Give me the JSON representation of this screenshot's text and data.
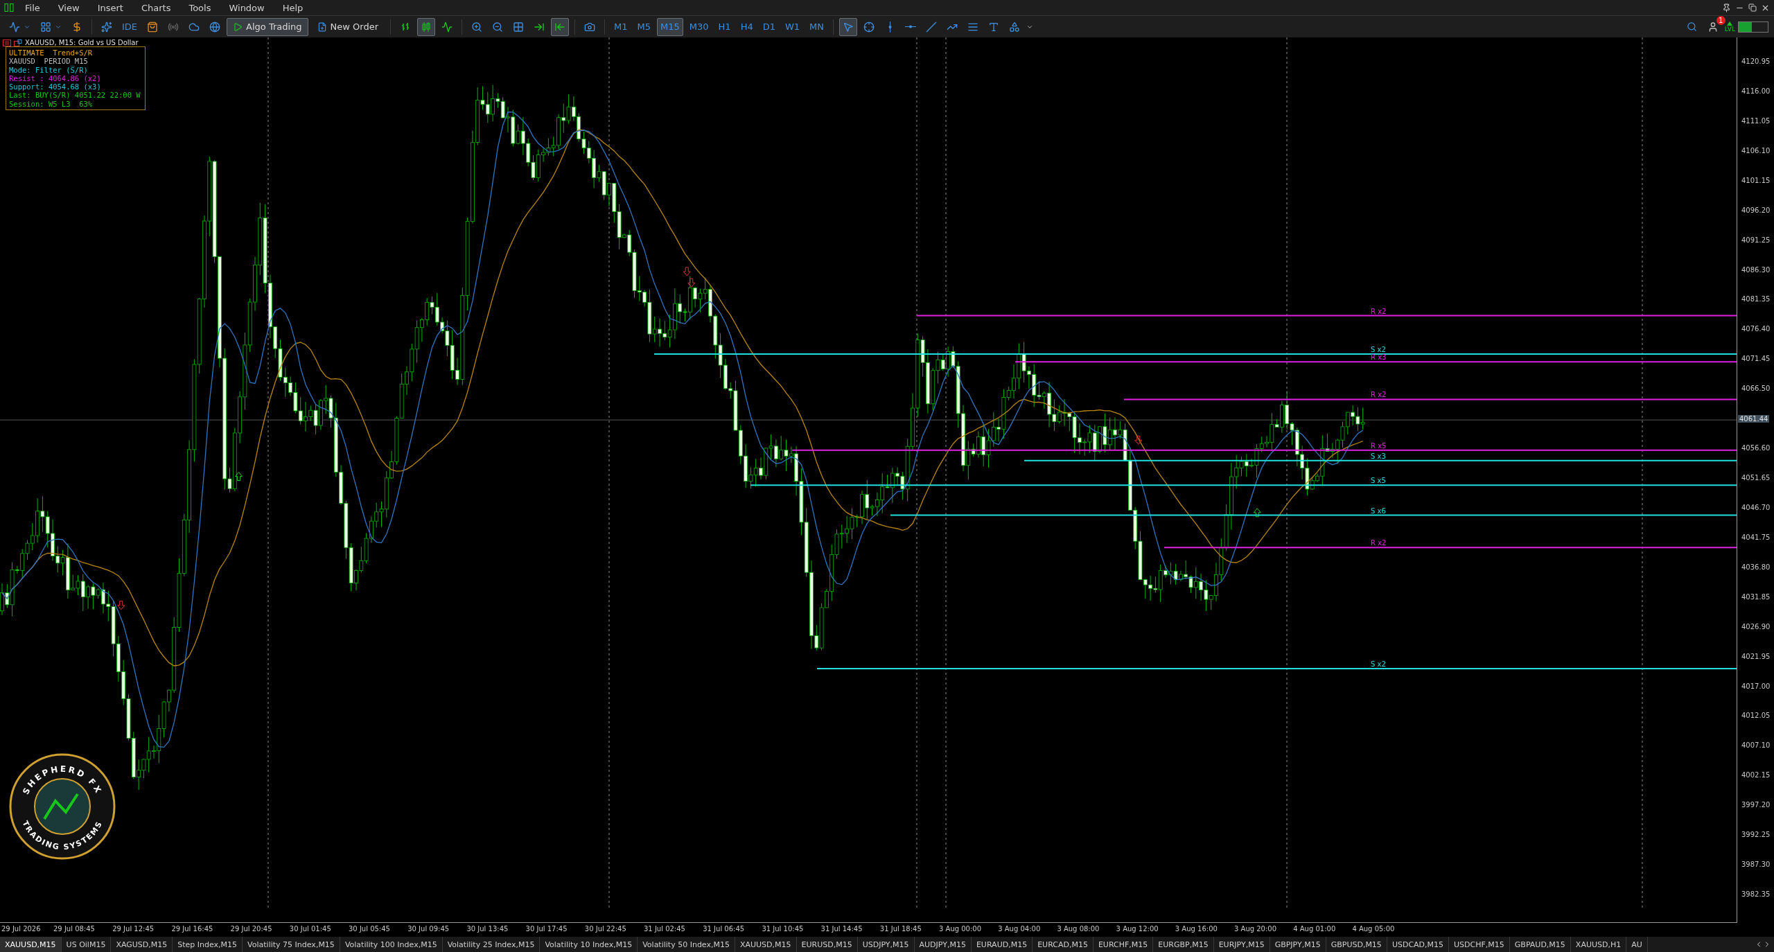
{
  "menu": [
    "File",
    "View",
    "Insert",
    "Charts",
    "Tools",
    "Window",
    "Help"
  ],
  "toolbar": {
    "ide_label": "IDE",
    "algo_trading": {
      "label": "Algo Trading",
      "on": true
    },
    "new_order": "New Order",
    "chart_types": [
      {
        "kind": "bars",
        "selected": false
      },
      {
        "kind": "candles",
        "selected": true
      },
      {
        "kind": "line",
        "selected": false
      }
    ],
    "view_toggles": [
      {
        "kind": "auto_scroll",
        "on": false
      },
      {
        "kind": "chart_shift",
        "on": true
      }
    ],
    "timeframes": [
      {
        "label": "M1",
        "selected": false
      },
      {
        "label": "M5",
        "selected": false
      },
      {
        "label": "M15",
        "selected": true
      },
      {
        "label": "M30",
        "selected": false
      },
      {
        "label": "H1",
        "selected": false
      },
      {
        "label": "H4",
        "selected": false
      },
      {
        "label": "D1",
        "selected": false
      },
      {
        "label": "W1",
        "selected": false
      },
      {
        "label": "MN",
        "selected": false
      }
    ],
    "tools": [
      {
        "kind": "cursor",
        "selected": true
      },
      {
        "kind": "crosshair",
        "selected": false
      },
      {
        "kind": "vline",
        "selected": false
      },
      {
        "kind": "hline",
        "selected": false
      },
      {
        "kind": "trend",
        "selected": false
      },
      {
        "kind": "channel",
        "selected": false
      },
      {
        "kind": "fibo",
        "selected": false
      },
      {
        "kind": "text",
        "selected": false
      },
      {
        "kind": "shapes",
        "selected": false
      }
    ],
    "notification_count": "1",
    "level_badge": "LVL"
  },
  "chart": {
    "title": "XAUUSD, M15:  Gold vs US Dollar",
    "info_panel": [
      {
        "text": "ULTIMATE  Trend+S/R",
        "color": "#e6a817"
      },
      {
        "text": "XAUUSD  PERIOD M15",
        "color": "#bfbfbf"
      },
      {
        "text": "Mode: Filter (S̅/R)",
        "color": "#22c7d6"
      },
      {
        "text": "Resist : 4064.86 (x2)",
        "color": "#e020e0"
      },
      {
        "text": "Support: 4054.68 (x3)",
        "color": "#22c7d6"
      },
      {
        "text": "Last: BUY(S/R) 4051.22 22:00 W",
        "color": "#18c818"
      },
      {
        "text": "Session: W5 L3  63%",
        "color": "#18c818"
      }
    ],
    "logo": {
      "top_text": "SHEPHERD FX",
      "bottom_text": "TRADING SYSTEMS"
    },
    "price_axis": [
      "4120.95",
      "4116.00",
      "4111.05",
      "4106.10",
      "4101.15",
      "4096.20",
      "4091.25",
      "4086.30",
      "4081.35",
      "4076.40",
      "4071.45",
      "4066.50",
      "4056.60",
      "4051.65",
      "4046.70",
      "4041.75",
      "4036.80",
      "4031.85",
      "4026.90",
      "4021.95",
      "4017.00",
      "4012.05",
      "4007.10",
      "4002.15",
      "3997.20",
      "3992.25",
      "3987.30",
      "3982.35"
    ],
    "current_price": "4061.44",
    "time_axis": [
      "29 Jul 2026",
      "29 Jul 08:45",
      "29 Jul 12:45",
      "29 Jul 16:45",
      "29 Jul 20:45",
      "30 Jul 01:45",
      "30 Jul 05:45",
      "30 Jul 09:45",
      "30 Jul 13:45",
      "30 Jul 17:45",
      "30 Jul 22:45",
      "31 Jul 02:45",
      "31 Jul 06:45",
      "31 Jul 10:45",
      "31 Jul 14:45",
      "31 Jul 18:45",
      "3 Aug 00:00",
      "3 Aug 04:00",
      "3 Aug 08:00",
      "3 Aug 12:00",
      "3 Aug 16:00",
      "3 Aug 20:00",
      "4 Aug 01:00",
      "4 Aug 05:00"
    ],
    "levels": [
      {
        "kind": "resistance",
        "label": "R x2"
      },
      {
        "kind": "support",
        "label": "S x2"
      },
      {
        "kind": "resistance",
        "label": "R x3"
      },
      {
        "kind": "resistance",
        "label": "R x2"
      },
      {
        "kind": "resistance",
        "label": "R x5"
      },
      {
        "kind": "support",
        "label": "S x3"
      },
      {
        "kind": "support",
        "label": "S x5"
      },
      {
        "kind": "support",
        "label": "S x6"
      },
      {
        "kind": "resistance",
        "label": "R x2"
      },
      {
        "kind": "support",
        "label": "S x2"
      }
    ]
  },
  "symbol_tabs": [
    {
      "label": "XAUUSD,M15",
      "selected": true
    },
    {
      "label": "US OilM15",
      "selected": false
    },
    {
      "label": "XAGUSD,M15",
      "selected": false
    },
    {
      "label": "Step Index,M15",
      "selected": false
    },
    {
      "label": "Volatility 75 Index,M15",
      "selected": false
    },
    {
      "label": "Volatility 100 Index,M15",
      "selected": false
    },
    {
      "label": "Volatility 25 Index,M15",
      "selected": false
    },
    {
      "label": "Volatility 10 Index,M15",
      "selected": false
    },
    {
      "label": "Volatility 50 Index,M15",
      "selected": false
    },
    {
      "label": "XAUUSD,M15",
      "selected": false
    },
    {
      "label": "EURUSD,M15",
      "selected": false
    },
    {
      "label": "USDJPY,M15",
      "selected": false
    },
    {
      "label": "AUDJPY,M15",
      "selected": false
    },
    {
      "label": "EURAUD,M15",
      "selected": false
    },
    {
      "label": "EURCAD,M15",
      "selected": false
    },
    {
      "label": "EURCHF,M15",
      "selected": false
    },
    {
      "label": "EURGBP,M15",
      "selected": false
    },
    {
      "label": "EURJPY,M15",
      "selected": false
    },
    {
      "label": "GBPJPY,M15",
      "selected": false
    },
    {
      "label": "GBPUSD,M15",
      "selected": false
    },
    {
      "label": "USDCAD,M15",
      "selected": false
    },
    {
      "label": "USDCHF,M15",
      "selected": false
    },
    {
      "label": "GBPAUD,M15",
      "selected": false
    },
    {
      "label": "XAUUSD,H1",
      "selected": false
    },
    {
      "label": "AU",
      "selected": false
    }
  ]
}
